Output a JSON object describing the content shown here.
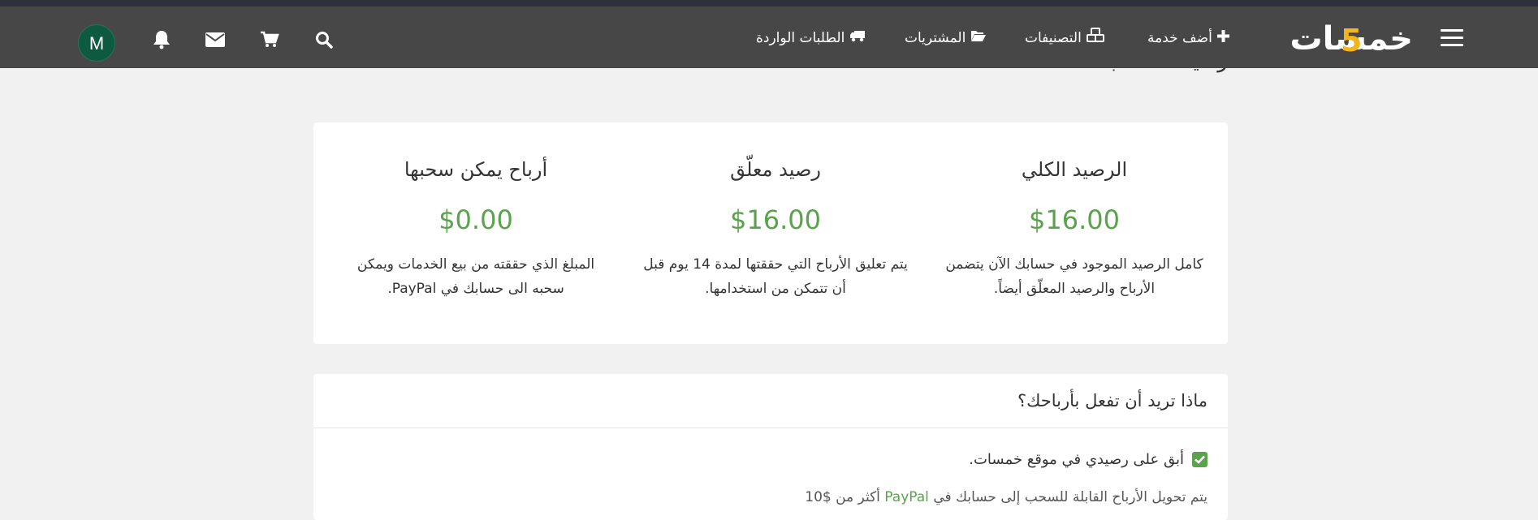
{
  "navbar": {
    "logo_text": "خمسات",
    "logo_digit": "5",
    "links": [
      {
        "label": "أضف خدمة",
        "icon": "plus-icon"
      },
      {
        "label": "التصنيفات",
        "icon": "cubes-icon"
      },
      {
        "label": "المشتريات",
        "icon": "folder-open-icon"
      },
      {
        "label": "الطلبات الواردة",
        "icon": "truck-icon"
      }
    ],
    "icons": [
      "search-icon",
      "cart-icon",
      "envelope-icon",
      "bell-icon"
    ],
    "avatar_letter": "M"
  },
  "page": {
    "title": "رصيد الحساب"
  },
  "balances": [
    {
      "title": "الرصيد الكلي",
      "value": "$16.00",
      "description": "كامل الرصيد الموجود في حسابك الآن يتضمن الأرباح والرصيد المعلّق أيضاً."
    },
    {
      "title": "رصيد معلّق",
      "value": "$16.00",
      "description": "يتم تعليق الأرباح التي حققتها لمدة 14 يوم قبل أن تتمكن من استخدامها."
    },
    {
      "title": "أرباح يمكن سحبها",
      "value": "$0.00",
      "description": "المبلغ الذي حققته من بيع الخدمات ويمكن سحبه الى حسابك في PayPal."
    }
  ],
  "earnings_action": {
    "title": "ماذا تريد أن تفعل بأرباحك؟",
    "option_label": "أبق على رصيدي في موقع خمسات.",
    "option_checked": true,
    "partial_text": "يتم تحويل الأرباح القابلة للسحب إلى حسابك في",
    "partial_link": "PayPal",
    "partial_tail": "أكثر من $10"
  },
  "colors": {
    "accent_green": "#5aa24c",
    "navbar_bg": "#474747",
    "logo_digit": "#f3b41c",
    "avatar_bg": "#0d5a40"
  }
}
